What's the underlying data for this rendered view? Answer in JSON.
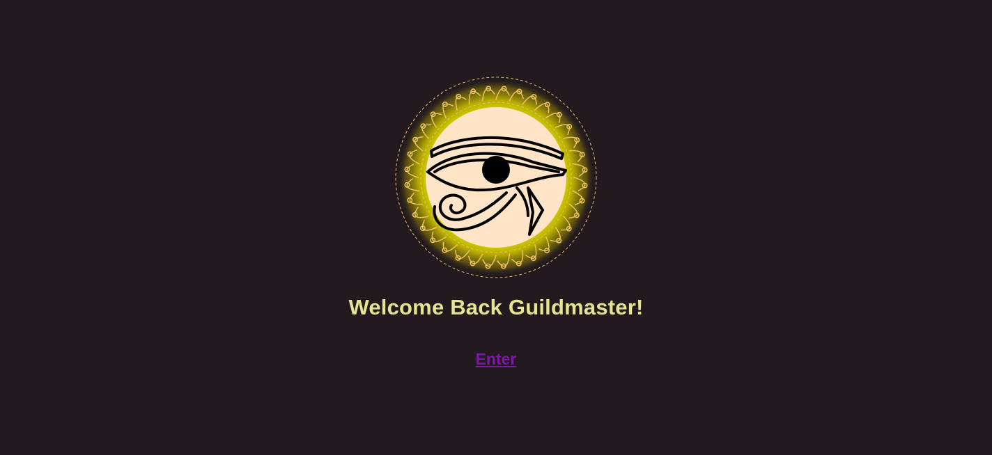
{
  "emblem": {
    "icon": "eye-of-horus-icon",
    "frame": "ornate-gold-ring",
    "glow_color": "#e4ea00",
    "disc_color": "#ffe4c8",
    "ornament_color": "#e7c25a",
    "ink_color": "#000000"
  },
  "welcome": {
    "title": "Welcome Back Guildmaster!",
    "title_color": "#e6e48f"
  },
  "actions": {
    "enter_label": "Enter",
    "enter_color": "#7a1aa6"
  },
  "theme": {
    "background": "#231a1f"
  }
}
